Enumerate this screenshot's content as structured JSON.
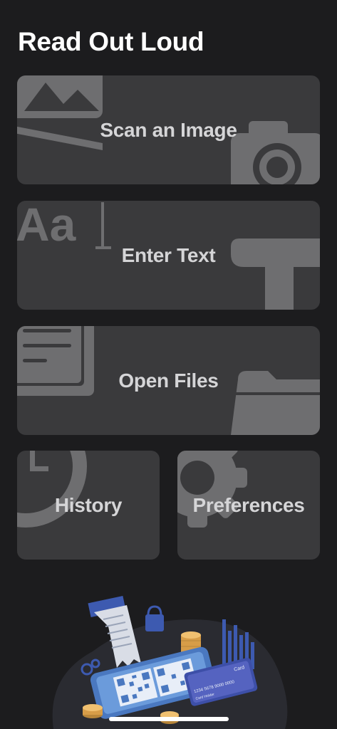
{
  "app": {
    "title": "Read Out Loud"
  },
  "actions": {
    "scan_image": "Scan an Image",
    "enter_text": "Enter Text",
    "open_files": "Open Files",
    "history": "History",
    "preferences": "Preferences"
  },
  "illustration": {
    "card_word": "Card",
    "card_number": "1234 5678 9000 0000",
    "card_holder": "Card Holder"
  },
  "colors": {
    "background": "#1c1c1e",
    "card": "#3a3a3c",
    "card_icon": "#6e6e70",
    "label": "#d5d5d7"
  }
}
